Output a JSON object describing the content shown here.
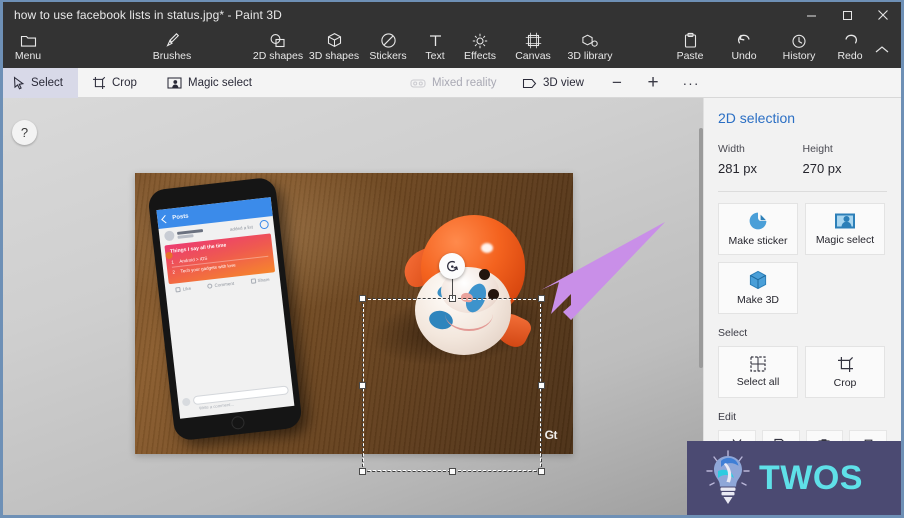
{
  "window": {
    "title": "how to use facebook lists in status.jpg* - Paint 3D",
    "minimize_label": "Minimize",
    "maximize_label": "Maximize",
    "close_label": "Close"
  },
  "ribbon": {
    "items": [
      {
        "label": "Menu",
        "icon": "menu-folder-icon"
      },
      {
        "label": "Brushes",
        "icon": "brush-icon"
      },
      {
        "label": "2D shapes",
        "icon": "2d-shapes-icon"
      },
      {
        "label": "3D shapes",
        "icon": "3d-shapes-icon"
      },
      {
        "label": "Stickers",
        "icon": "stickers-icon"
      },
      {
        "label": "Text",
        "icon": "text-icon"
      },
      {
        "label": "Effects",
        "icon": "effects-icon"
      },
      {
        "label": "Canvas",
        "icon": "canvas-icon"
      },
      {
        "label": "3D library",
        "icon": "3d-library-icon"
      },
      {
        "label": "Paste",
        "icon": "paste-icon"
      },
      {
        "label": "Undo",
        "icon": "undo-icon"
      },
      {
        "label": "History",
        "icon": "history-icon"
      },
      {
        "label": "Redo",
        "icon": "redo-icon"
      }
    ],
    "collapse_icon": "chevron-up-icon"
  },
  "subtoolbar": {
    "items": [
      {
        "label": "Select",
        "icon": "cursor-select-icon",
        "active": true,
        "disabled": false
      },
      {
        "label": "Crop",
        "icon": "crop-icon",
        "active": false,
        "disabled": false
      },
      {
        "label": "Magic select",
        "icon": "magic-select-icon",
        "active": false,
        "disabled": false
      },
      {
        "label": "Mixed reality",
        "icon": "mixed-reality-icon",
        "active": false,
        "disabled": true
      },
      {
        "label": "3D view",
        "icon": "3d-view-icon",
        "active": false,
        "disabled": false
      }
    ],
    "zoom_out_label": "−",
    "zoom_in_label": "+",
    "more_label": "···"
  },
  "workspace": {
    "help_label": "?",
    "image_watermark": "Gt",
    "phone": {
      "app_title": "Posts",
      "added_text": "added a list",
      "card_title": "Things I say all the time",
      "rows": [
        {
          "num": "1",
          "text": "Android > iOS"
        },
        {
          "num": "2",
          "text": "Tech your gadgets with love"
        }
      ],
      "actions": [
        "Like",
        "Comment",
        "Share"
      ],
      "comment_placeholder": "Write a comment..."
    },
    "annotation_arrow_color": "#c98fe8"
  },
  "panel": {
    "title": "2D selection",
    "width_label": "Width",
    "width_value": "281 px",
    "height_label": "Height",
    "height_value": "270 px",
    "cards": [
      {
        "label": "Make sticker",
        "icon": "sticker-icon"
      },
      {
        "label": "Magic select",
        "icon": "magic-select-icon"
      },
      {
        "label": "Make 3D",
        "icon": "cube-icon"
      }
    ],
    "select_section_label": "Select",
    "select_buttons": [
      {
        "label": "Select all",
        "icon": "select-all-icon"
      },
      {
        "label": "Crop",
        "icon": "crop-icon"
      }
    ],
    "edit_section_label": "Edit",
    "edit_buttons": [
      {
        "name": "cut",
        "icon": "scissors-icon"
      },
      {
        "name": "copy",
        "icon": "copy-icon"
      },
      {
        "name": "paste",
        "icon": "paste-icon"
      },
      {
        "name": "delete",
        "icon": "trash-icon"
      }
    ]
  },
  "watermark": {
    "text": "TWOS",
    "logo_icon": "lightbulb-icon",
    "background": "#4b4a72",
    "text_color": "#5fe0e8"
  },
  "colors": {
    "titlebar": "#333333",
    "panel_title": "#2b6fc4",
    "active_tool": "#d8d9e8",
    "window_border": "#6e90b6"
  }
}
